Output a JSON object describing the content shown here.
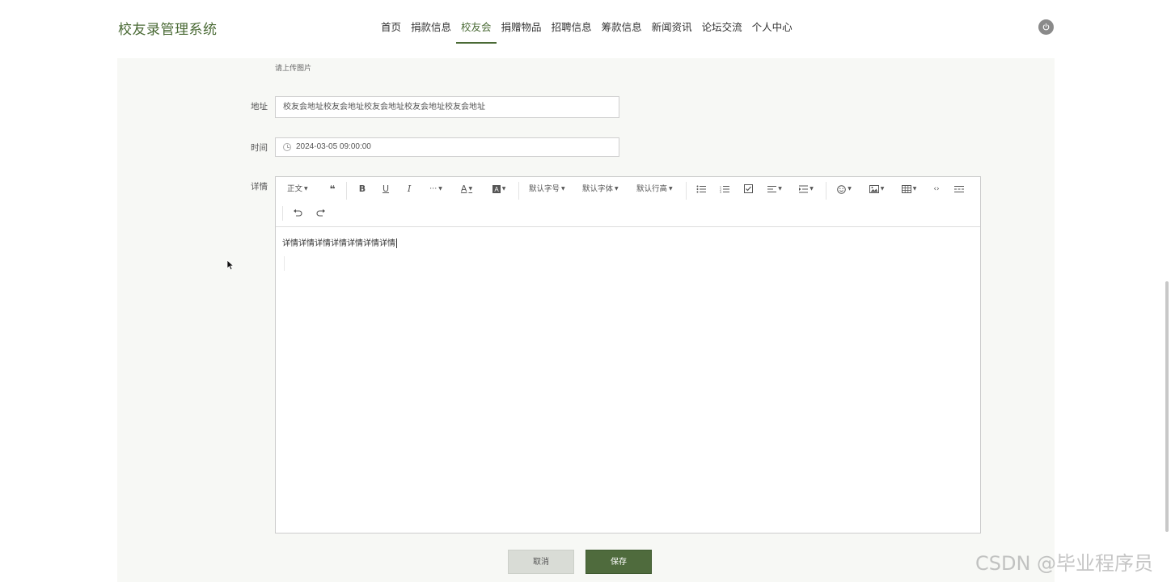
{
  "app": {
    "title": "校友录管理系统"
  },
  "nav": {
    "items": [
      {
        "label": "首页",
        "active": false
      },
      {
        "label": "捐款信息",
        "active": false
      },
      {
        "label": "校友会",
        "active": true
      },
      {
        "label": "捐赠物品",
        "active": false
      },
      {
        "label": "招聘信息",
        "active": false
      },
      {
        "label": "筹款信息",
        "active": false
      },
      {
        "label": "新闻资讯",
        "active": false
      },
      {
        "label": "论坛交流",
        "active": false
      },
      {
        "label": "个人中心",
        "active": false
      }
    ],
    "power_icon": "power-icon"
  },
  "form": {
    "upload_hint": "请上传图片",
    "address": {
      "label": "地址",
      "value": "校友会地址校友会地址校友会地址校友会地址校友会地址"
    },
    "time": {
      "label": "时间",
      "value": "2024-03-05 09:00:00",
      "icon": "clock-icon"
    },
    "details": {
      "label": "详情"
    }
  },
  "editor": {
    "toolbar": {
      "paragraph": "正文",
      "font_size": "默认字号",
      "font_family": "默认字体",
      "line_height": "默认行高"
    },
    "content": "详情详情详情详情详情详情详情"
  },
  "actions": {
    "cancel": "取消",
    "save": "保存"
  },
  "watermark": "CSDN @毕业程序员",
  "colors": {
    "brand": "#4a6a35",
    "save_button": "#4f6b3d",
    "panel_bg": "#f7f8f5"
  }
}
